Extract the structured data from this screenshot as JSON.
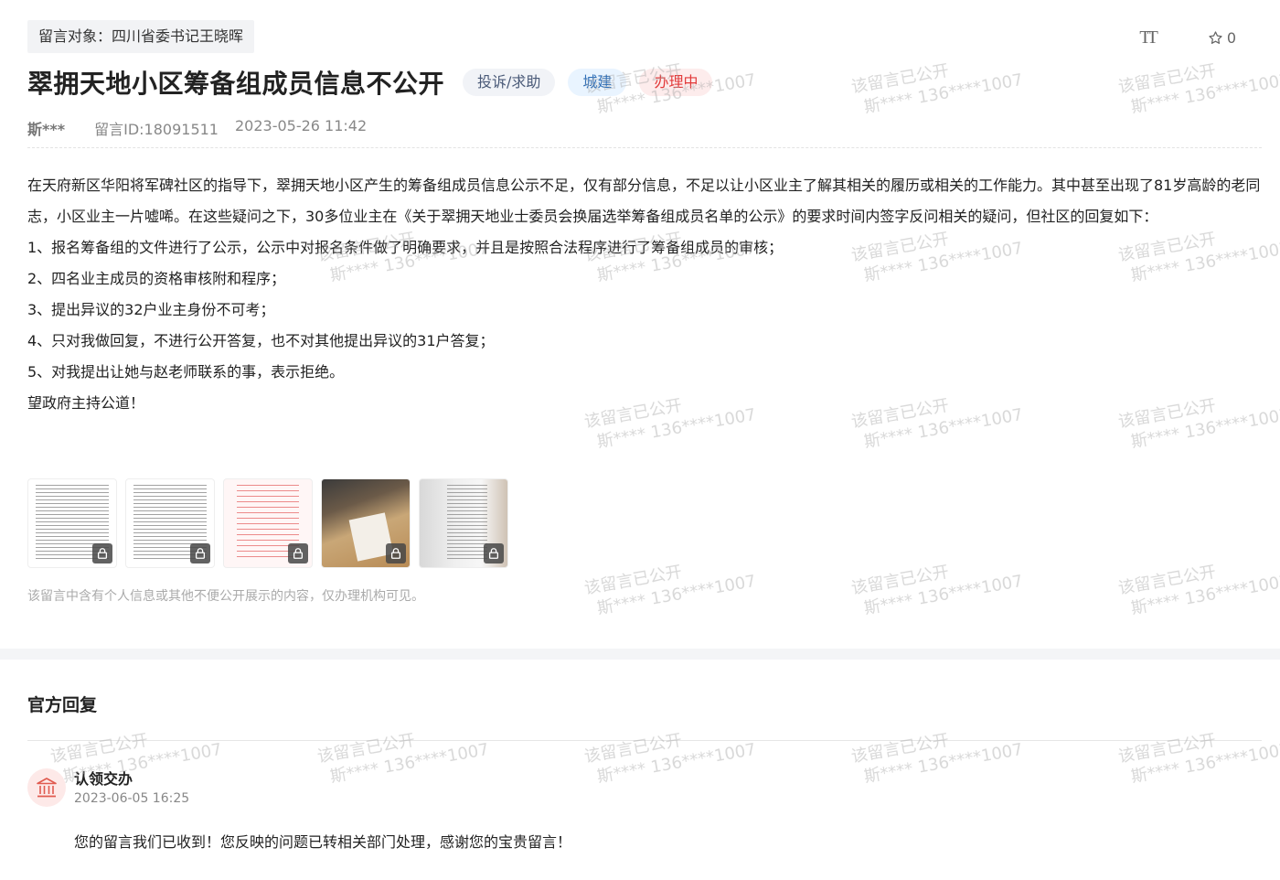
{
  "header": {
    "target_label": "留言对象：四川省委书记王晓晖",
    "font_size_icon": "TT",
    "favorite_count": "0",
    "title": "翠拥天地小区筹备组成员信息不公开",
    "tags": {
      "type": "投诉/求助",
      "category": "城建",
      "status": "办理中"
    },
    "colors": {
      "status": "#e23a3a",
      "category": "#2f6fb8"
    }
  },
  "meta": {
    "author": "斯***",
    "message_id": "留言ID:18091511",
    "datetime": "2023-05-26 11:42"
  },
  "content": {
    "paragraphs": [
      "在天府新区华阳将军碑社区的指导下，翠拥天地小区产生的筹备组成员信息公示不足，仅有部分信息，不足以让小区业主了解其相关的履历或相关的工作能力。其中甚至出现了81岁高龄的老同志，小区业主一片嘘唏。在这些疑问之下，30多位业主在《关于翠拥天地业士委员会换届选举筹备组成员名单的公示》的要求时间内签字反问相关的疑问，但社区的回复如下：",
      "1、报名筹备组的文件进行了公示，公示中对报名条件做了明确要求，并且是按照合法程序进行了筹备组成员的审核；",
      "2、四名业主成员的资格审核附和程序；",
      "3、提出异议的32户业主身份不可考；",
      "4、只对我做回复，不进行公开答复，也不对其他提出异议的31户答复；",
      "5、对我提出让她与赵老师联系的事，表示拒绝。",
      "望政府主持公道！"
    ]
  },
  "attachments": {
    "count": 5,
    "note": "该留言中含有个人信息或其他不便公开展示的内容，仅办理机构可见。"
  },
  "reply": {
    "heading": "官方回复",
    "name": "认领交办",
    "time": "2023-06-05 16:25",
    "text": "您的留言我们已收到！您反映的问题已转相关部门处理，感谢您的宝贵留言！"
  },
  "watermark": {
    "line1": "该留言已公开",
    "line2": "斯**** 136****1007"
  }
}
